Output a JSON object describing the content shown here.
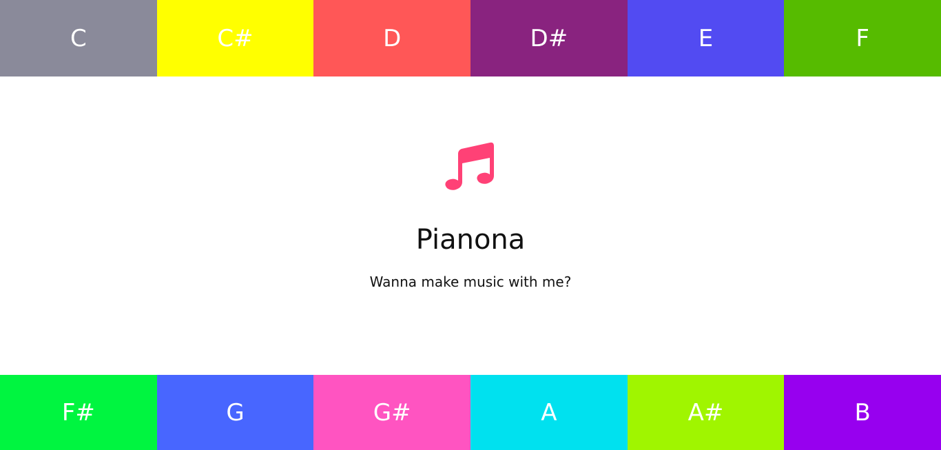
{
  "app": {
    "title": "Pianona",
    "subtitle": "Wanna make music with me?",
    "icon": "music-note-icon",
    "icon_color": "#ff4176"
  },
  "keys_top": [
    {
      "label": "C",
      "color": "#8a8a9a"
    },
    {
      "label": "C#",
      "color": "#ffff00"
    },
    {
      "label": "D",
      "color": "#ff5757"
    },
    {
      "label": "D#",
      "color": "#89237f"
    },
    {
      "label": "E",
      "color": "#524bf2"
    },
    {
      "label": "F",
      "color": "#56bb00"
    }
  ],
  "keys_bottom": [
    {
      "label": "F#",
      "color": "#00f540"
    },
    {
      "label": "G",
      "color": "#4866ff"
    },
    {
      "label": "G#",
      "color": "#ff54c1"
    },
    {
      "label": "A",
      "color": "#00e1ef"
    },
    {
      "label": "A#",
      "color": "#a0f500"
    },
    {
      "label": "B",
      "color": "#9700ef"
    }
  ]
}
